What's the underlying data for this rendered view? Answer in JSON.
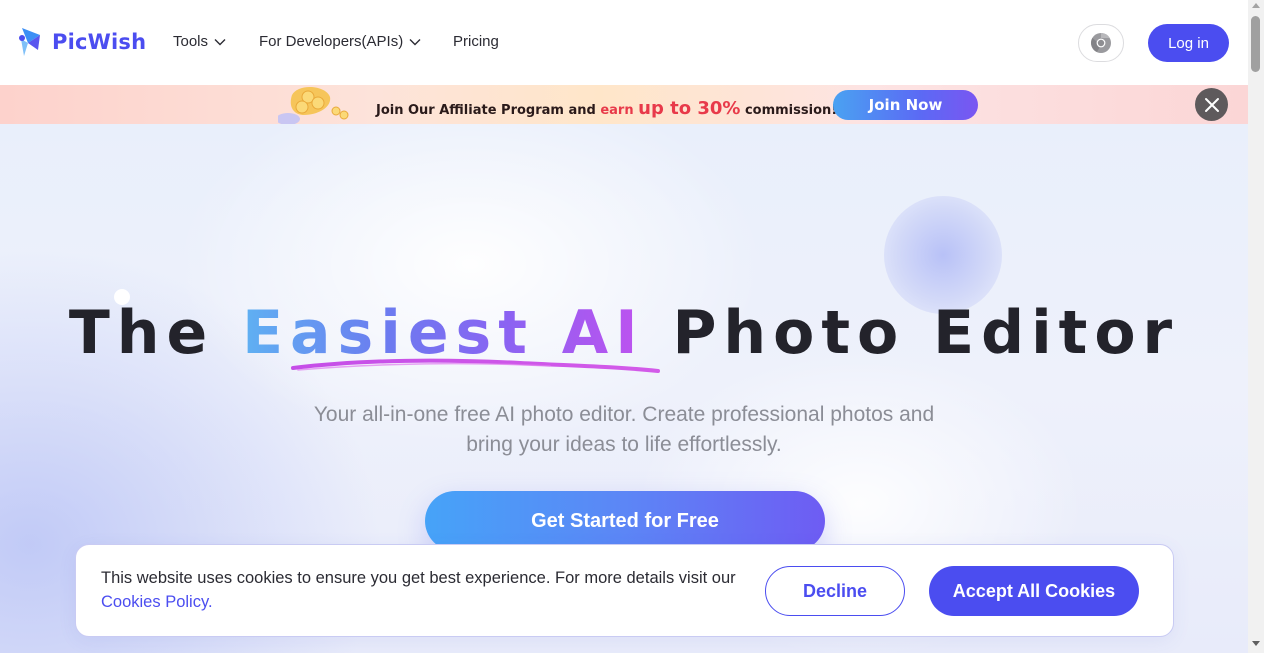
{
  "brand": {
    "name": "PicWish",
    "color": "#4b4df0"
  },
  "nav": {
    "items": [
      {
        "label": "Tools",
        "has_dropdown": true
      },
      {
        "label": "For Developers(APIs)",
        "has_dropdown": true
      },
      {
        "label": "Pricing",
        "has_dropdown": false
      }
    ],
    "chrome_icon": "chrome-icon",
    "login_label": "Log in"
  },
  "banner": {
    "text_join": "Join  Our Affiliate Program and ",
    "text_earn": "earn ",
    "text_pct": "up to 30%",
    "text_tail": " commission!",
    "cta_label": "Join Now",
    "close_icon": "close-icon"
  },
  "hero": {
    "headline_plain_before": "The ",
    "headline_highlight": "Easiest AI",
    "headline_plain_after": " Photo Editor",
    "subtitle_line1": "Your all-in-one free AI photo editor. Create professional photos and",
    "subtitle_line2": "bring your ideas to life effortlessly.",
    "cta_label": "Get Started for Free"
  },
  "cookie": {
    "text": "This website uses cookies to ensure you get best experience. For more details visit our ",
    "link_label": "Cookies Policy.",
    "decline_label": "Decline",
    "accept_label": "Accept All Cookies"
  }
}
